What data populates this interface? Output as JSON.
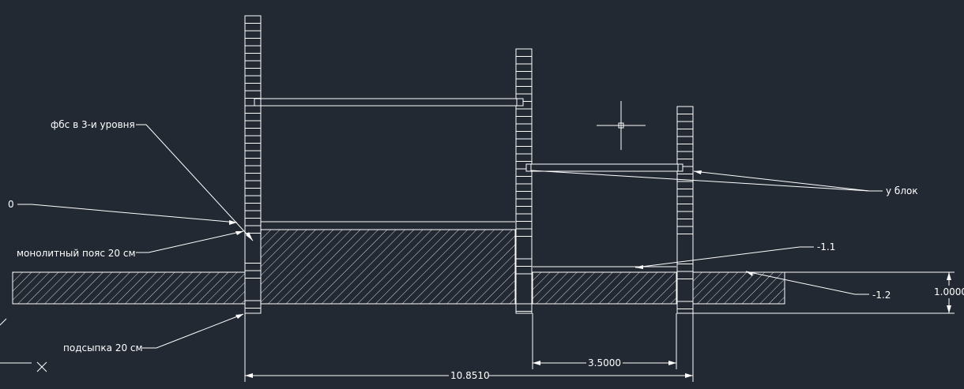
{
  "background_color": "#222933",
  "line_color": "#ffffff",
  "labels": {
    "fbs": "фбс в 3-и уровня",
    "zero": "0",
    "belt": "монолитный пояс 20 см",
    "fill": "подсыпка 20 см",
    "u_block": "у блок",
    "minus_1_1": "-1.1",
    "minus_1_2": "-1.2"
  },
  "dimensions": {
    "height": "1.0000",
    "span_small": "3.5000",
    "span_total": "10.8510"
  }
}
